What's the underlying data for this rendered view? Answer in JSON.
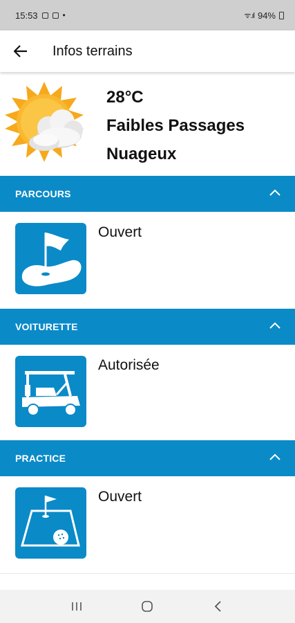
{
  "status_bar": {
    "time": "15:53",
    "battery": "94%"
  },
  "app_bar": {
    "title": "Infos terrains",
    "back_icon": "arrow-left-icon"
  },
  "weather": {
    "temperature": "28°C",
    "line1": "Faibles Passages",
    "line2": "Nuageux",
    "icon": "sun-cloud-icon"
  },
  "sections": [
    {
      "title": "PARCOURS",
      "status": "Ouvert",
      "icon": "golf-flag-green-icon",
      "expanded": true
    },
    {
      "title": "VOITURETTE",
      "status": "Autorisée",
      "icon": "golf-cart-icon",
      "expanded": true
    },
    {
      "title": "PRACTICE",
      "status": "Ouvert",
      "icon": "practice-range-icon",
      "expanded": true
    }
  ],
  "colors": {
    "accent": "#0b8ac8",
    "sun": "#f6a91c",
    "status_bar": "#cfcfcf"
  }
}
